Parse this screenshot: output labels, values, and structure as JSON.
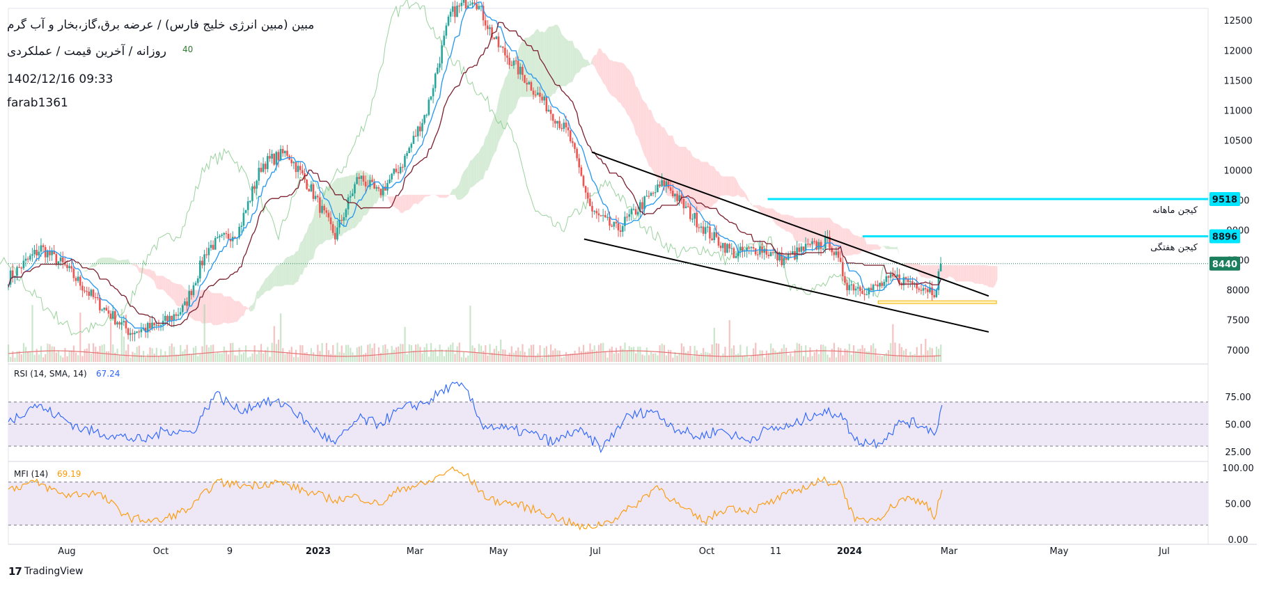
{
  "header": {
    "symbol_line": "مبین (مبین انرژی خلیج فارس) / عرضه برق،گاز،بخار و آب گرم",
    "interval_line": "روزانه / آخرین قیمت / عملکردی",
    "datetime": "1402/12/16 09:33",
    "author": "farab1361",
    "volume_ma_label": "40"
  },
  "brand": {
    "name": "TradingView",
    "logo_text": "17"
  },
  "colors": {
    "up": "#26a69a",
    "down": "#ef5350",
    "kijun": "#7b1e2e",
    "tenkan": "#2196f3",
    "chikou": "#81c784",
    "cloud_bull": "#c8e6c9",
    "cloud_bear": "#ffcdd2",
    "rsi": "#2962ff",
    "mfi": "#ff9800",
    "band": "#ede7f6",
    "level_line": "#00e5ff",
    "current_price_bg": "#1b7f5e"
  },
  "chart_data": [
    {
      "type": "candlestick",
      "title": "مبین (مبین انرژی خلیج فارس) / عرضه برق،گاز،بخار و آب گرم",
      "x_axis_ticks": [
        "Aug",
        "Oct",
        "9",
        "2023",
        "Mar",
        "May",
        "Jul",
        "Oct",
        "11",
        "2024",
        "Mar",
        "May",
        "Jul"
      ],
      "y_axis_ticks": [
        12500,
        12000,
        11500,
        11000,
        10500,
        10000,
        9500,
        9000,
        8500,
        8000,
        7500,
        7000
      ],
      "ylim": [
        6800,
        12700
      ],
      "grid": false,
      "close_path": [
        [
          "2022-07-15",
          8200
        ],
        [
          "2022-08-05",
          8700
        ],
        [
          "2022-08-20",
          8400
        ],
        [
          "2022-09-10",
          7800
        ],
        [
          "2022-10-01",
          7300
        ],
        [
          "2022-10-20",
          7400
        ],
        [
          "2022-11-05",
          7700
        ],
        [
          "2022-11-20",
          8700
        ],
        [
          "2022-12-10",
          9000
        ],
        [
          "2022-12-25",
          10100
        ],
        [
          "2023-01-10",
          10300
        ],
        [
          "2023-01-25",
          9700
        ],
        [
          "2023-02-10",
          8900
        ],
        [
          "2023-02-25",
          9900
        ],
        [
          "2023-03-10",
          9600
        ],
        [
          "2023-03-25",
          10100
        ],
        [
          "2023-04-10",
          11000
        ],
        [
          "2023-04-25",
          12600
        ],
        [
          "2023-05-10",
          12900
        ],
        [
          "2023-05-25",
          12100
        ],
        [
          "2023-06-10",
          11600
        ],
        [
          "2023-06-25",
          11100
        ],
        [
          "2023-07-10",
          10600
        ],
        [
          "2023-07-25",
          9300
        ],
        [
          "2023-08-10",
          9000
        ],
        [
          "2023-08-25",
          9400
        ],
        [
          "2023-09-10",
          9800
        ],
        [
          "2023-09-25",
          9300
        ],
        [
          "2023-10-10",
          8900
        ],
        [
          "2023-10-25",
          8600
        ],
        [
          "2023-11-10",
          8700
        ],
        [
          "2023-11-25",
          8500
        ],
        [
          "2023-12-10",
          8700
        ],
        [
          "2023-12-25",
          8800
        ],
        [
          "2024-01-05",
          8100
        ],
        [
          "2024-01-20",
          8000
        ],
        [
          "2024-02-05",
          8200
        ],
        [
          "2024-02-20",
          8100
        ],
        [
          "2024-03-01",
          7980
        ],
        [
          "2024-03-06",
          8440
        ]
      ],
      "indicators": [
        "Ichimoku Cloud",
        "Volume (20, SMA, 9)"
      ],
      "drawings": [
        {
          "name": "falling-wedge-upper",
          "from": [
            "2023-07-25",
            10300
          ],
          "to": [
            "2024-04-05",
            7900
          ]
        },
        {
          "name": "falling-wedge-lower",
          "from": [
            "2023-07-20",
            8850
          ],
          "to": [
            "2024-04-05",
            7300
          ]
        },
        {
          "name": "support-zone",
          "from": [
            "2024-01-25",
            7780
          ],
          "to": [
            "2024-04-10",
            7820
          ]
        }
      ],
      "price_levels": [
        {
          "value": 9518,
          "label": "کیجن ماهانه"
        },
        {
          "value": 8896,
          "label": "کیجن هفتگی"
        }
      ],
      "current_price": 8440
    },
    {
      "type": "line",
      "title": "RSI (14, SMA, 14)",
      "current_value": "67.24",
      "y_axis_ticks": [
        "75.00",
        "50.00",
        "25.00"
      ],
      "ylim": [
        18,
        102
      ],
      "bands": [
        30,
        70
      ],
      "middle": 50,
      "series": [
        {
          "name": "RSI",
          "points": [
            [
              "2022-07-15",
              52
            ],
            [
              "2022-08-01",
              68
            ],
            [
              "2022-08-15",
              58
            ],
            [
              "2022-09-01",
              45
            ],
            [
              "2022-09-20",
              40
            ],
            [
              "2022-10-10",
              35
            ],
            [
              "2022-10-25",
              45
            ],
            [
              "2022-11-10",
              42
            ],
            [
              "2022-11-25",
              78
            ],
            [
              "2022-12-10",
              62
            ],
            [
              "2022-12-25",
              70
            ],
            [
              "2023-01-10",
              68
            ],
            [
              "2023-01-25",
              48
            ],
            [
              "2023-02-10",
              32
            ],
            [
              "2023-02-25",
              55
            ],
            [
              "2023-03-10",
              50
            ],
            [
              "2023-03-25",
              64
            ],
            [
              "2023-04-10",
              70
            ],
            [
              "2023-04-25",
              85
            ],
            [
              "2023-05-05",
              82
            ],
            [
              "2023-05-15",
              50
            ],
            [
              "2023-06-01",
              45
            ],
            [
              "2023-06-15",
              42
            ],
            [
              "2023-07-01",
              33
            ],
            [
              "2023-07-15",
              45
            ],
            [
              "2023-08-01",
              28
            ],
            [
              "2023-08-15",
              55
            ],
            [
              "2023-09-01",
              63
            ],
            [
              "2023-09-15",
              48
            ],
            [
              "2023-10-01",
              38
            ],
            [
              "2023-10-15",
              45
            ],
            [
              "2023-11-01",
              35
            ],
            [
              "2023-11-15",
              45
            ],
            [
              "2023-12-01",
              48
            ],
            [
              "2023-12-15",
              60
            ],
            [
              "2024-01-01",
              60
            ],
            [
              "2024-01-10",
              35
            ],
            [
              "2024-01-25",
              33
            ],
            [
              "2024-02-10",
              53
            ],
            [
              "2024-02-25",
              48
            ],
            [
              "2024-03-01",
              40
            ],
            [
              "2024-03-06",
              67.24
            ]
          ]
        }
      ]
    },
    {
      "type": "line",
      "title": "MFI (14)",
      "current_value": "69.19",
      "y_axis_ticks": [
        "100.00",
        "50.00",
        "0.00"
      ],
      "ylim": [
        -5,
        105
      ],
      "bands": [
        20,
        80
      ],
      "series": [
        {
          "name": "MFI",
          "points": [
            [
              "2022-07-15",
              70
            ],
            [
              "2022-08-01",
              80
            ],
            [
              "2022-08-20",
              62
            ],
            [
              "2022-09-10",
              65
            ],
            [
              "2022-10-01",
              30
            ],
            [
              "2022-10-20",
              25
            ],
            [
              "2022-11-10",
              45
            ],
            [
              "2022-11-25",
              80
            ],
            [
              "2022-12-15",
              75
            ],
            [
              "2023-01-05",
              80
            ],
            [
              "2023-01-25",
              65
            ],
            [
              "2023-02-10",
              55
            ],
            [
              "2023-02-25",
              60
            ],
            [
              "2023-03-10",
              48
            ],
            [
              "2023-03-25",
              72
            ],
            [
              "2023-04-10",
              78
            ],
            [
              "2023-04-25",
              98
            ],
            [
              "2023-05-05",
              90
            ],
            [
              "2023-05-20",
              55
            ],
            [
              "2023-06-05",
              50
            ],
            [
              "2023-06-20",
              40
            ],
            [
              "2023-07-05",
              28
            ],
            [
              "2023-07-20",
              15
            ],
            [
              "2023-08-05",
              25
            ],
            [
              "2023-08-20",
              45
            ],
            [
              "2023-09-05",
              75
            ],
            [
              "2023-09-20",
              45
            ],
            [
              "2023-10-05",
              25
            ],
            [
              "2023-10-20",
              45
            ],
            [
              "2023-11-05",
              40
            ],
            [
              "2023-11-20",
              55
            ],
            [
              "2023-12-05",
              70
            ],
            [
              "2023-12-20",
              82
            ],
            [
              "2024-01-01",
              78
            ],
            [
              "2024-01-10",
              25
            ],
            [
              "2024-01-25",
              30
            ],
            [
              "2024-02-10",
              58
            ],
            [
              "2024-02-25",
              52
            ],
            [
              "2024-03-01",
              28
            ],
            [
              "2024-03-06",
              69.19
            ]
          ]
        }
      ]
    }
  ]
}
